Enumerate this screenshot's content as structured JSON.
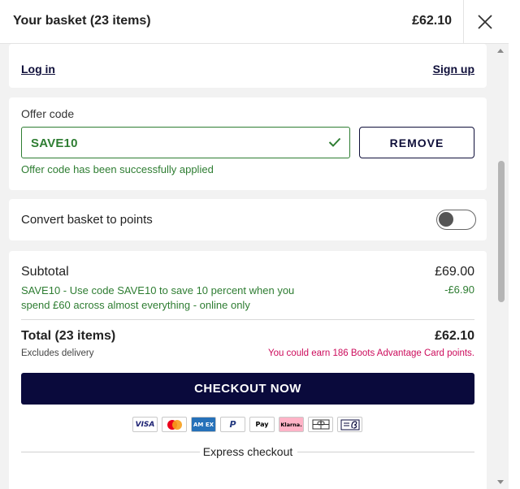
{
  "header": {
    "title": "Your basket (23 items)",
    "total": "£62.10"
  },
  "account": {
    "login_label": "Log in",
    "signup_label": "Sign up"
  },
  "offer": {
    "label": "Offer code",
    "code_value": "SAVE10",
    "remove_label": "REMOVE",
    "success_message": "Offer code has been successfully applied"
  },
  "convert": {
    "label": "Convert basket to points",
    "enabled": false
  },
  "summary": {
    "subtotal_label": "Subtotal",
    "subtotal_value": "£69.00",
    "promo_text": "SAVE10 - Use code SAVE10 to save 10 percent when you spend £60 across almost everything - online only",
    "promo_value": "-£6.90",
    "total_label": "Total (23 items)",
    "total_value": "£62.10",
    "excludes_text": "Excludes delivery",
    "points_text": "You could earn 186 Boots Advantage Card points.",
    "checkout_label": "CHECKOUT NOW",
    "express_label": "Express checkout"
  },
  "payment_methods": {
    "visa": "VISA",
    "mastercard": "mastercard-icon",
    "amex": "AM EX",
    "paypal": "P",
    "applepay": "Pay",
    "klarna": "Klarna.",
    "giftcard": "giftcard-icon",
    "boots": "boots-card-icon"
  },
  "colors": {
    "navy": "#0a0a3c",
    "success": "#2e7d32",
    "points": "#cc0c5c"
  }
}
